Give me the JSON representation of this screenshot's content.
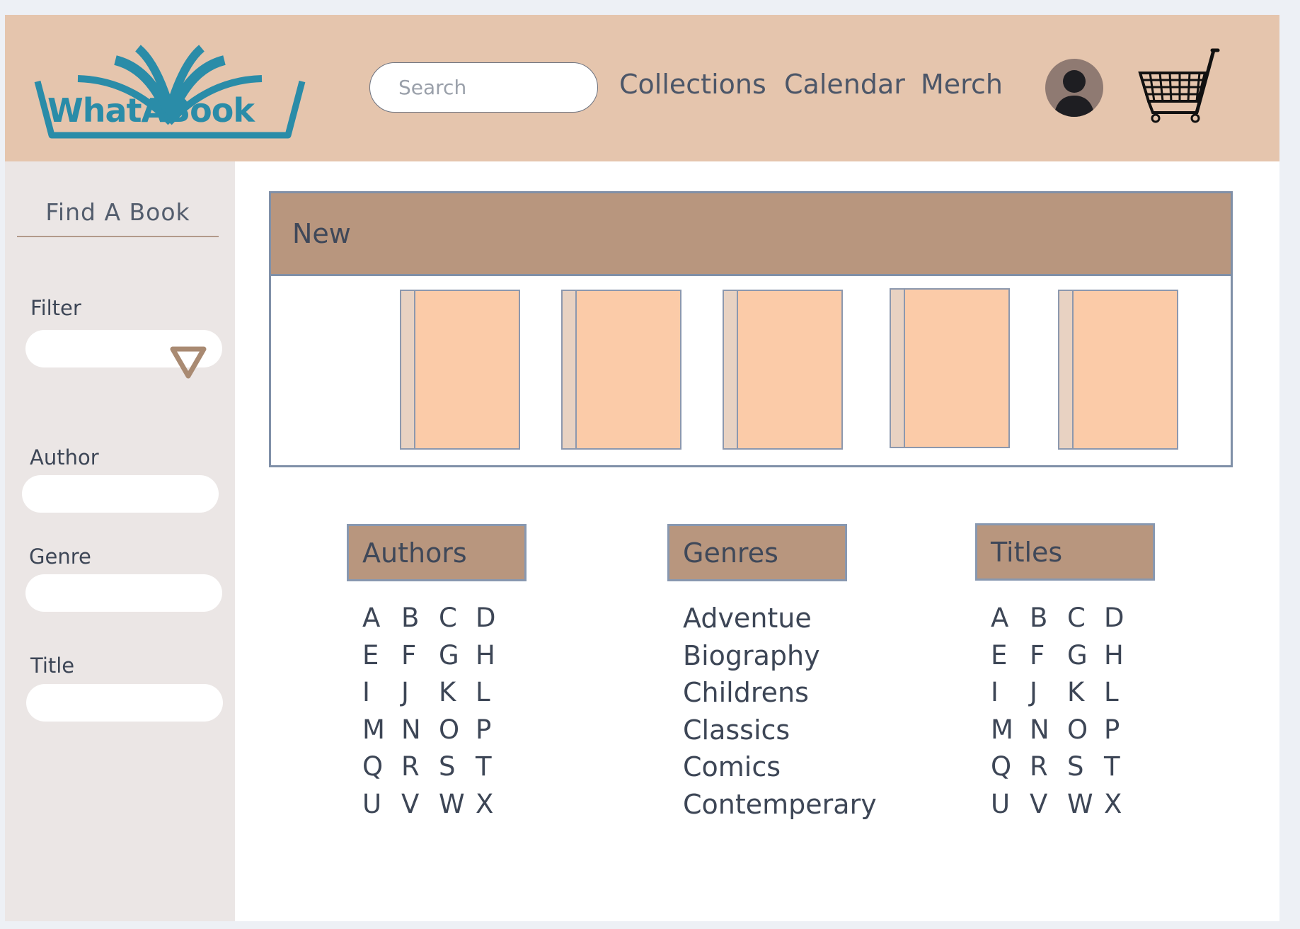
{
  "header": {
    "logo_text": "WhatABook",
    "search_placeholder": "Search",
    "nav": [
      "Collections",
      "Calendar",
      "Merch"
    ]
  },
  "sidebar": {
    "title": "Find A Book",
    "filter_label": "Filter",
    "author_label": "Author",
    "genre_label": "Genre",
    "title_label": "Title"
  },
  "new_section": {
    "title": "New",
    "book_count": 5
  },
  "authors": {
    "title": "Authors",
    "letters": [
      [
        "A",
        "B",
        "C",
        "D"
      ],
      [
        "E",
        "F",
        "G",
        "H"
      ],
      [
        "I",
        "J",
        "K",
        "L"
      ],
      [
        "M",
        "N",
        "O",
        "P"
      ],
      [
        "Q",
        "R",
        "S",
        "T"
      ],
      [
        "U",
        "V",
        "W",
        "X"
      ]
    ]
  },
  "genres": {
    "title": "Genres",
    "items": [
      "Adventue",
      "Biography",
      "Childrens",
      "Classics",
      "Comics",
      "Contemperary"
    ]
  },
  "titles": {
    "title": "Titles",
    "letters": [
      [
        "A",
        "B",
        "C",
        "D"
      ],
      [
        "E",
        "F",
        "G",
        "H"
      ],
      [
        "I",
        "J",
        "K",
        "L"
      ],
      [
        "M",
        "N",
        "O",
        "P"
      ],
      [
        "Q",
        "R",
        "S",
        "T"
      ],
      [
        "U",
        "V",
        "W",
        "X"
      ]
    ]
  },
  "colors": {
    "header_bg": "#e5c5ad",
    "sidebar_bg": "#ebe6e5",
    "section_header": "#b8967e",
    "book_cover": "#fbcba8",
    "logo_teal": "#2a8ca8"
  }
}
